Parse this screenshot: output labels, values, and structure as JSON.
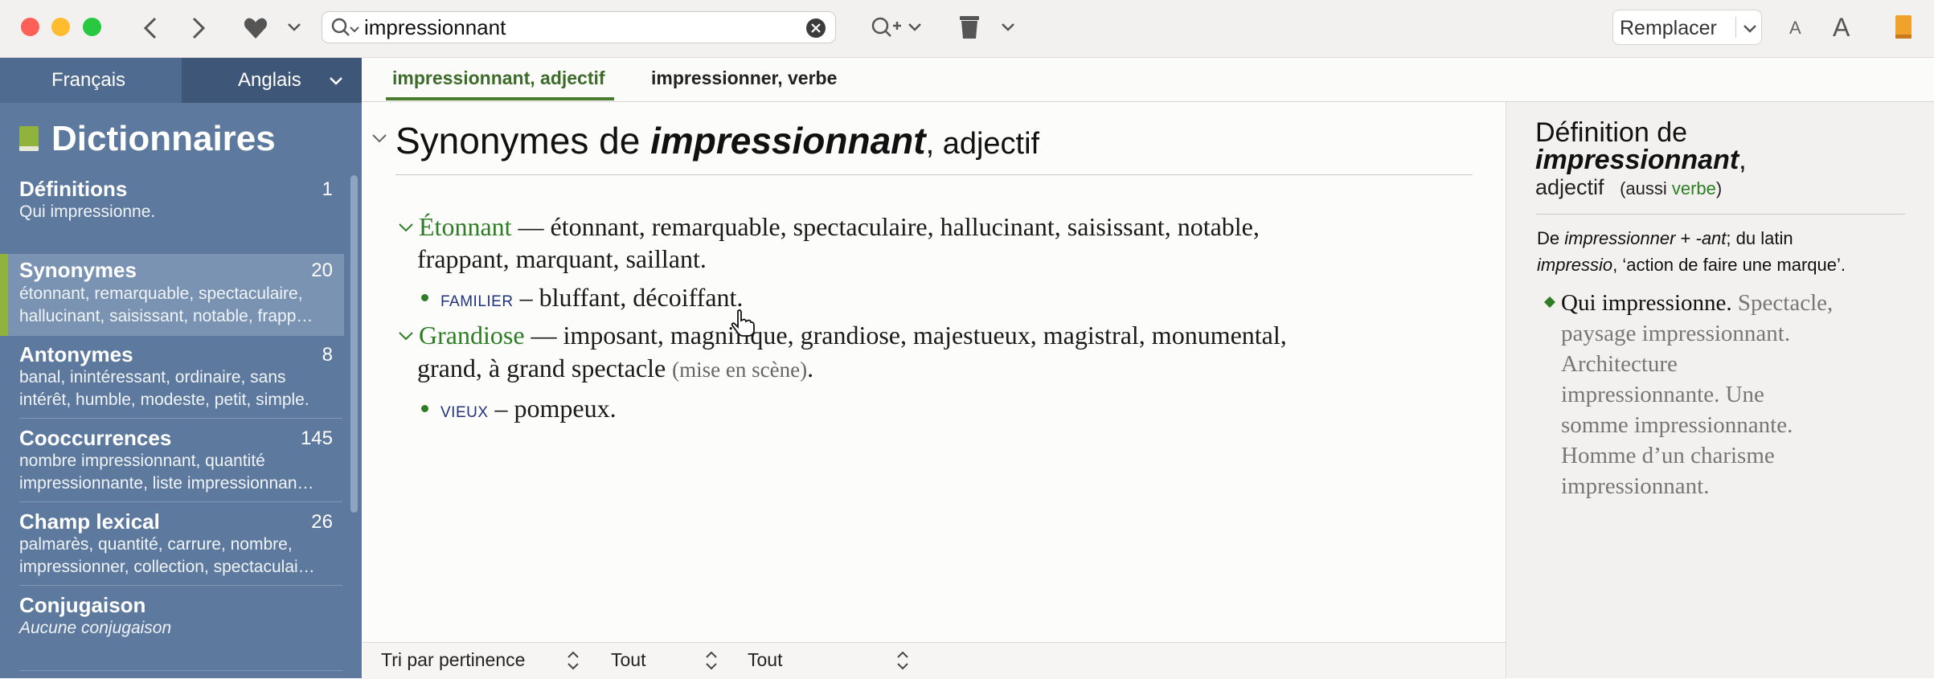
{
  "toolbar": {
    "search_value": "impressionnant",
    "replace_label": "Remplacer",
    "font_small": "A",
    "font_large": "A"
  },
  "sidebar": {
    "lang_left": "Français",
    "lang_right": "Anglais",
    "heading": "Dictionnaires",
    "items": [
      {
        "title": "Définitions",
        "count": "1",
        "desc": "Qui impressionne."
      },
      {
        "title": "Synonymes",
        "count": "20",
        "desc": "étonnant, remarquable, spectaculaire, hallucinant, saisissant, notable, frapp…"
      },
      {
        "title": "Antonymes",
        "count": "8",
        "desc": "banal, inintéressant, ordinaire, sans intérêt, humble, modeste, petit, simple."
      },
      {
        "title": "Cooccurrences",
        "count": "145",
        "desc": "nombre impressionnant, quantité impressionnante, liste impressionnan…"
      },
      {
        "title": "Champ lexical",
        "count": "26",
        "desc": "palmarès, quantité, carrure, nombre, impressionner, collection, spectaculai…"
      },
      {
        "title": "Conjugaison",
        "count": "",
        "desc": "Aucune conjugaison"
      }
    ]
  },
  "tabs": [
    {
      "label": "impressionnant, adjectif"
    },
    {
      "label": "impressionner, verbe"
    }
  ],
  "main": {
    "heading_prefix": "Synonymes de ",
    "heading_word": "impressionnant",
    "heading_suffix": ", adjectif",
    "entries": [
      {
        "head": "Étonnant",
        "text": " — étonnant, remarquable, spectaculaire, hallucinant, saisissant, notable,",
        "text2": "frappant, marquant, saillant.",
        "sub_label": "FAMILIER",
        "sub_text": " – bluffant, décoiffant."
      },
      {
        "head": "Grandiose",
        "text": " — imposant, magnifique, grandiose, majestueux, magistral, monumental,",
        "text2": "grand, à grand spectacle ",
        "text2_note": "(mise en scène)",
        "text2_end": ".",
        "sub_label": "VIEUX",
        "sub_text": " – pompeux."
      }
    ]
  },
  "right_panel": {
    "title_1": "Définition de",
    "title_word": "impressionnant",
    "title_comma": ",",
    "pos": "adjectif",
    "also_prefix": "(aussi ",
    "also_link": "verbe",
    "also_suffix": ")",
    "ety_1a": "De ",
    "ety_1b": "impressionner",
    "ety_1c": " + ",
    "ety_1d": "-ant",
    "ety_1e": "; du latin",
    "ety_2a": "impressio",
    "ety_2b": ", ‘action de faire une marque’.",
    "def_head": "Qui impressionne.",
    "def_ex_1": " Spectacle,",
    "def_ex_2": "paysage impressionnant.",
    "def_ex_3": "Architecture",
    "def_ex_4": "impressionnante. Une",
    "def_ex_5": "somme impressionnante.",
    "def_ex_6": "Homme d’un charisme",
    "def_ex_7": "impressionnant."
  },
  "bottombar": {
    "sort": "Tri par pertinence",
    "filter1": "Tout",
    "filter2": "Tout"
  },
  "colors": {
    "sidebar_bg": "#5d7a9e",
    "accent_green": "#2d7d24",
    "selected_marker": "#8fb33c"
  }
}
